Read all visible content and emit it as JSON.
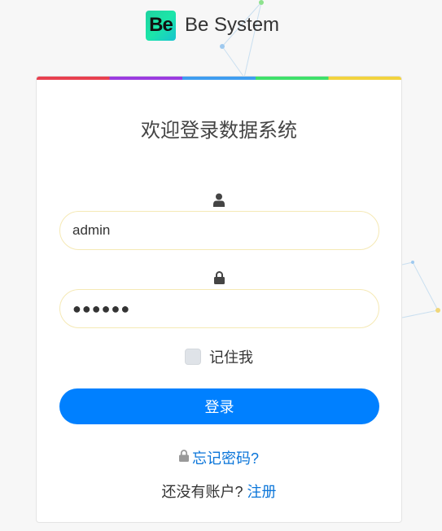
{
  "brand": {
    "logo_text": "Be",
    "name": "Be System"
  },
  "login": {
    "title": "欢迎登录数据系统",
    "username_value": "admin",
    "password_value": "●●●●●●",
    "remember_label": "记住我",
    "submit_label": "登录",
    "forgot_label": "忘记密码?",
    "register_prompt": "还没有账户?",
    "register_label": "注册"
  },
  "icons": {
    "username": "user-icon",
    "password": "lock-icon",
    "forgot": "lock-icon"
  },
  "colors": {
    "primary": "#0080ff",
    "link": "#0a75d9",
    "stripe": [
      "#e8404f",
      "#9b3ce0",
      "#3f9df0",
      "#3fe06a",
      "#f2d33e"
    ]
  }
}
